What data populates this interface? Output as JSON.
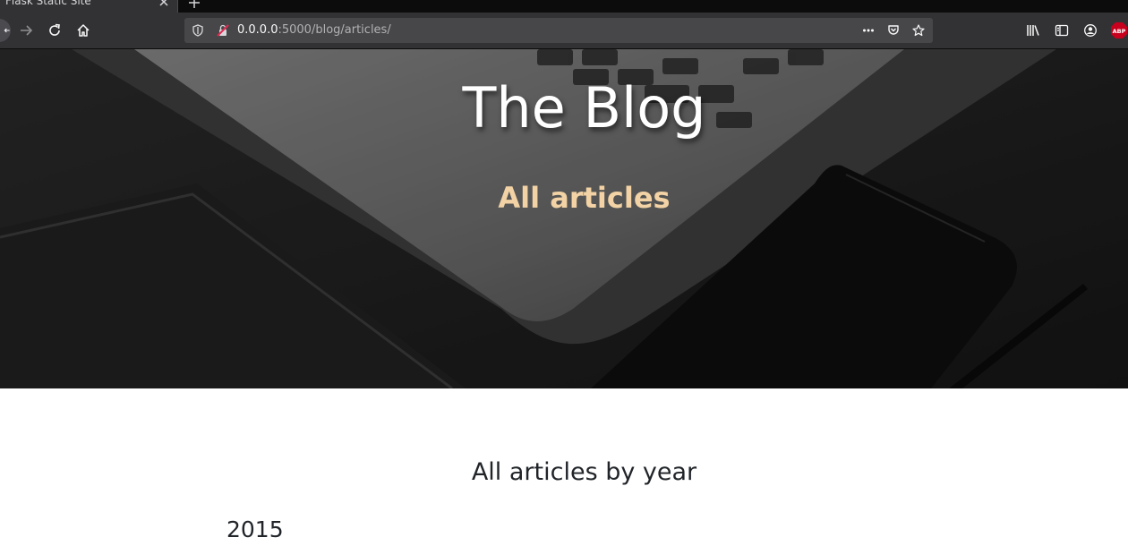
{
  "browser": {
    "tab_title": "Flask Static Site",
    "url": {
      "host": "0.0.0.0",
      "path": ":5000/blog/articles/"
    }
  },
  "hero": {
    "title": "The Blog",
    "subtitle": "All articles"
  },
  "content": {
    "heading": "All articles by year",
    "years": [
      "2015"
    ]
  },
  "icons": {
    "back": "back-arrow-icon",
    "forward": "forward-arrow-icon",
    "reload": "reload-icon",
    "home": "home-icon",
    "shield": "tracking-shield-icon",
    "insecure": "insecure-connection-icon",
    "page_actions": "more-actions-icon",
    "pocket": "pocket-icon",
    "bookmark": "bookmark-star-icon",
    "library": "library-icon",
    "sidebar": "sidebar-icon",
    "account": "account-icon",
    "adblock": "adblock-plus-icon"
  },
  "colors": {
    "subtitle": "#f3d3a5",
    "adblock_badge": "#c7001e"
  }
}
